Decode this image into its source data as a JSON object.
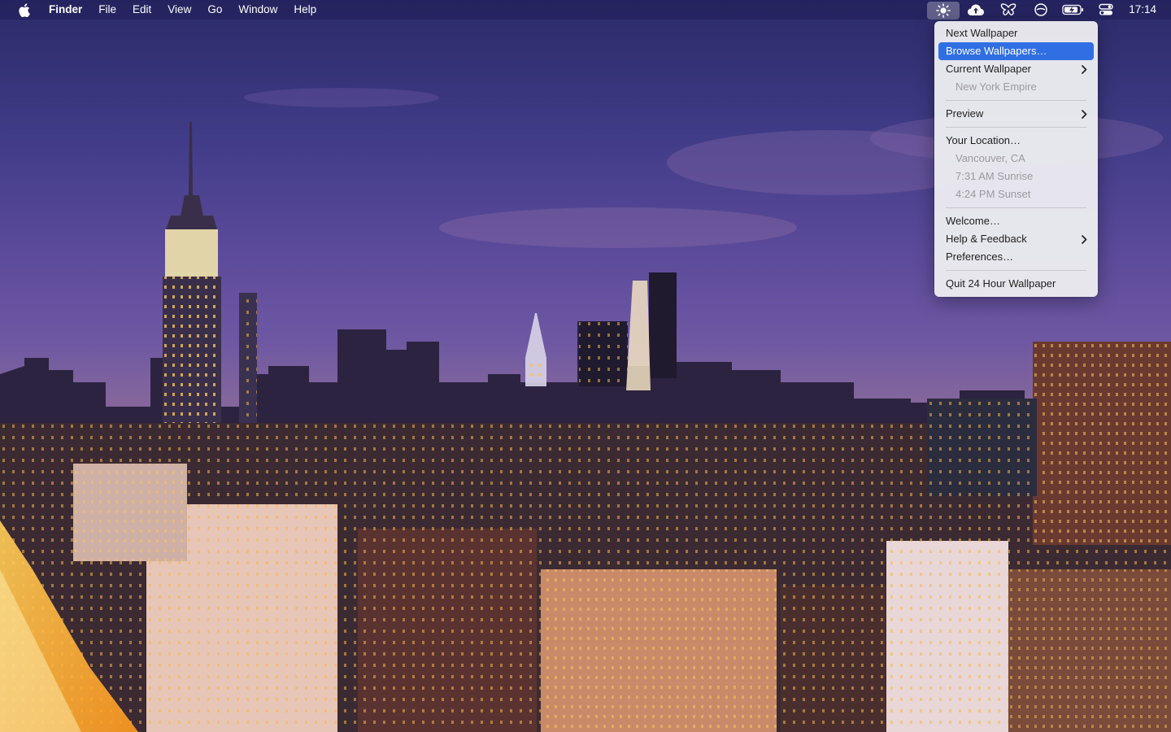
{
  "menubar": {
    "app_name": "Finder",
    "menus": [
      "File",
      "Edit",
      "View",
      "Go",
      "Window",
      "Help"
    ],
    "status_icons": [
      "brightness-icon",
      "cloud-upload-icon",
      "butterfly-icon",
      "circle-icon",
      "battery-charging-icon",
      "control-center-icon"
    ],
    "clock": "17:14"
  },
  "dropdown": {
    "next_wallpaper": "Next Wallpaper",
    "browse_wallpapers": "Browse Wallpapers…",
    "current_wallpaper": "Current Wallpaper",
    "current_wallpaper_name": "New York Empire",
    "preview": "Preview",
    "your_location": "Your Location…",
    "location_city": "Vancouver, CA",
    "sunrise": "7:31 AM Sunrise",
    "sunset": "4:24 PM Sunset",
    "welcome": "Welcome…",
    "help_feedback": "Help & Feedback",
    "preferences": "Preferences…",
    "quit": "Quit 24 Hour Wallpaper"
  },
  "colors": {
    "highlight": "#2f6fe3",
    "menubar_bg": "#22215c"
  }
}
